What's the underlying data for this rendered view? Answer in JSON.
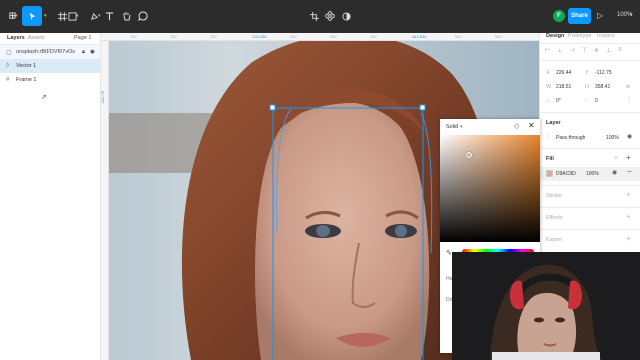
{
  "toolbar": {
    "tools": [
      "main-menu-icon",
      "move-tool-icon",
      "frame-tool-icon",
      "shape-tool-icon",
      "pen-tool-icon",
      "text-tool-icon",
      "hand-tool-icon",
      "comment-tool-icon"
    ],
    "center_tools": [
      "crop-icon",
      "component-icon",
      "contrast-icon"
    ],
    "avatar_initial": "F",
    "share_label": "Share",
    "zoom": "100%"
  },
  "left_panel": {
    "tabs": [
      "Layers",
      "Assets"
    ],
    "page": "Page 1",
    "layers": [
      {
        "name": "unsplash:rBIFDVf07vOs",
        "type": "image"
      },
      {
        "name": "Vector 1",
        "type": "vector"
      },
      {
        "name": "Frame 1",
        "type": "frame"
      }
    ]
  },
  "rulers": {
    "top_values": [
      "100",
      "150",
      "200",
      "226.438",
      "300",
      "350",
      "400",
      "444.544",
      "500",
      "550"
    ],
    "left_values": [
      "-112.75"
    ]
  },
  "right_panel": {
    "tabs": [
      "Design",
      "Prototype",
      "Inspect"
    ],
    "x": "226.44",
    "y": "-112.75",
    "w": "218.51",
    "h": "358.41",
    "rotation": "0°",
    "radius": "0",
    "layer": {
      "title": "Layer",
      "blend": "Pass through",
      "opacity": "100%"
    },
    "fill": {
      "title": "Fill",
      "hex": "D9AC9D",
      "opacity": "100%",
      "swatch": "#d9ac9d"
    },
    "stroke": "Stroke",
    "effects": "Effects",
    "export": "Export"
  },
  "picker": {
    "mode": "Solid",
    "accent": "#e8832a"
  },
  "colors": {
    "accent": "#0d99ff",
    "dark_ui": "#2c2c2c"
  }
}
